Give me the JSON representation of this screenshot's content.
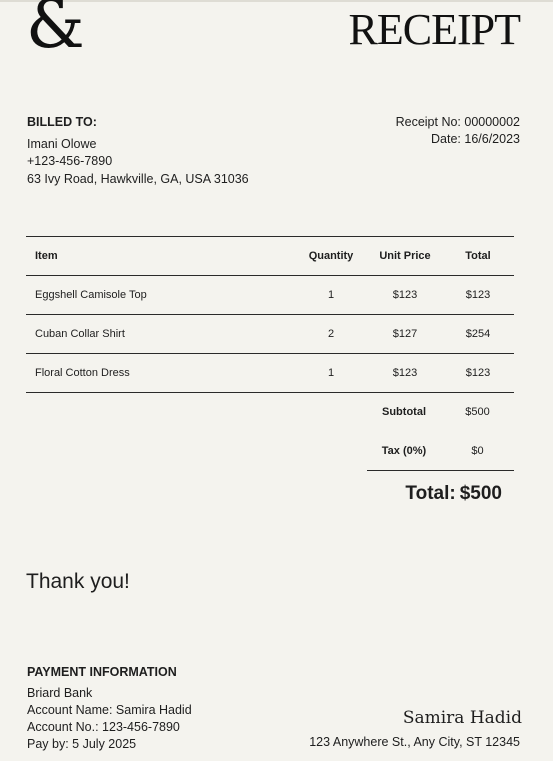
{
  "logo": "&",
  "title": "RECEIPT",
  "billed_to": {
    "heading": "BILLED TO:",
    "name": "Imani Olowe",
    "phone": "+123-456-7890",
    "address": "63 Ivy Road, Hawkville, GA, USA 31036"
  },
  "meta": {
    "receipt_no": "Receipt No: 00000002",
    "date": "Date: 16/6/2023"
  },
  "table": {
    "headers": {
      "item": "Item",
      "quantity": "Quantity",
      "unit_price": "Unit Price",
      "total": "Total"
    },
    "rows": [
      {
        "item": "Eggshell Camisole Top",
        "quantity": "1",
        "unit_price": "$123",
        "total": "$123"
      },
      {
        "item": "Cuban Collar Shirt",
        "quantity": "2",
        "unit_price": "$127",
        "total": "$254"
      },
      {
        "item": "Floral Cotton Dress",
        "quantity": "1",
        "unit_price": "$123",
        "total": "$123"
      }
    ]
  },
  "summary": {
    "subtotal_label": "Subtotal",
    "subtotal_value": "$500",
    "tax_label": "Tax (0%)",
    "tax_value": "$0",
    "total_label": "Total:",
    "total_value": "$500"
  },
  "thank_you": "Thank you!",
  "payment": {
    "heading": "PAYMENT INFORMATION",
    "bank": "Briard Bank",
    "account_name": "Account Name: Samira Hadid",
    "account_no": "Account No.: 123-456-7890",
    "pay_by": "Pay by: 5 July 2025"
  },
  "signature": "Samira Hadid",
  "company_address": "123 Anywhere St., Any City, ST 12345"
}
